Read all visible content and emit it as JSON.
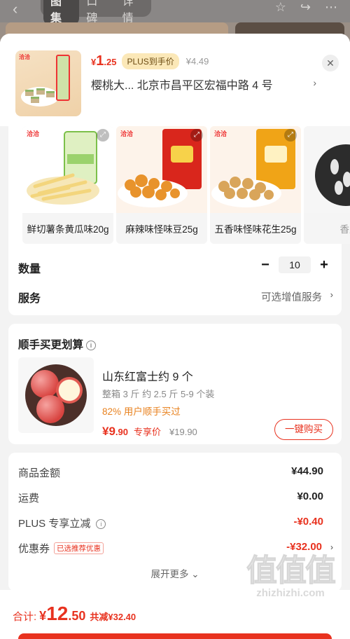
{
  "background_header": {
    "tabs": [
      "图集",
      "口碑",
      "详情"
    ]
  },
  "product": {
    "price_symbol": "¥",
    "price_int": "1",
    "price_dec": ".25",
    "plus_tag": "PLUS到手价",
    "original_price": "¥4.49",
    "address": "樱桃大...  北京市昌平区宏福中路 4 号",
    "thumb_logo": "洽洽"
  },
  "variants": [
    {
      "label": "鲜切薯条黄瓜味20g",
      "logo": "洽洽"
    },
    {
      "label": "麻辣味怪味豆25g",
      "logo": "洽洽"
    },
    {
      "label": "五香味怪味花生25g",
      "logo": "洽洽"
    },
    {
      "label": "香瓜",
      "logo": ""
    }
  ],
  "quantity": {
    "label": "数量",
    "value": "10"
  },
  "service": {
    "label": "服务",
    "value": "可选增值服务"
  },
  "addon": {
    "title": "顺手买更划算",
    "name": "山东红富士约 9 个",
    "spec": "整箱 3 斤  约 2.5 斤  5-9 个装",
    "percent": "82% 用户顺手买过",
    "price_int": "¥9",
    "price_dec": ".90",
    "price_label": "专享价",
    "original": "¥19.90",
    "buy_button": "一键购买"
  },
  "summary": {
    "goods_label": "商品金额",
    "goods_value": "¥44.90",
    "shipping_label": "运费",
    "shipping_value": "¥0.00",
    "plus_label": "PLUS 专享立减",
    "plus_value": "-¥0.40",
    "coupon_label": "优惠券",
    "coupon_tag": "已选推荐优惠",
    "coupon_value": "-¥32.00",
    "expand": "展开更多 ⌄"
  },
  "footer": {
    "total_label": "合计:",
    "currency": "¥",
    "total_int": "12",
    "total_dec": ".50",
    "discount": "共减¥32.40"
  },
  "watermark": {
    "text": "zhizhizhi.com"
  },
  "colors": {
    "accent": "#e8321f",
    "plus_tag_bg": "#fbe8b8",
    "addon_pct": "#e8821f"
  }
}
